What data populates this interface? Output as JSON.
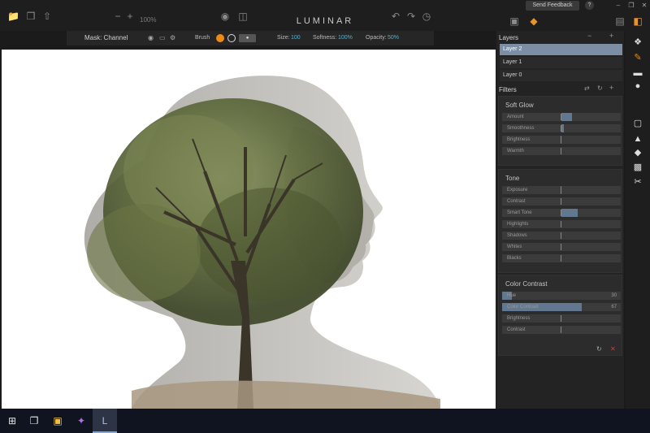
{
  "toolbar": {
    "zoom": "100%",
    "title": "LUMINAR",
    "feedback_label": "Send Feedback",
    "help_label": "?",
    "minimize": "–",
    "restore": "❐",
    "close": "✕"
  },
  "mask_bar": {
    "title": "Mask: Channel",
    "brush_label": "Brush",
    "size_label": "Size:",
    "size_value": "100",
    "softness_label": "Softness:",
    "softness_value": "100%",
    "opacity_label": "Opacity:",
    "opacity_value": "50%"
  },
  "layers": {
    "title": "Layers",
    "items": [
      {
        "label": "Layer 2",
        "active": true
      },
      {
        "label": "Layer 1",
        "active": false
      },
      {
        "label": "Layer 0",
        "active": false
      }
    ]
  },
  "filters": {
    "title": "Filters",
    "groups": [
      {
        "title": "Soft Glow",
        "sliders": [
          {
            "label": "Amount",
            "level": 0.59
          },
          {
            "label": "Smoothness",
            "level": 0.52
          },
          {
            "label": "Brightness",
            "level": 0.49
          },
          {
            "label": "Warmth",
            "level": 0.5
          }
        ]
      },
      {
        "title": "Tone",
        "sliders": [
          {
            "label": "Exposure",
            "level": 0.49
          },
          {
            "label": "Contrast",
            "level": 0.5
          },
          {
            "label": "Smart Tone",
            "level": 0.64
          },
          {
            "label": "Highlights",
            "level": 0.5
          },
          {
            "label": "Shadows",
            "level": 0.5
          },
          {
            "label": "Whites",
            "level": 0.5
          },
          {
            "label": "Blacks",
            "level": 0.5
          }
        ]
      },
      {
        "title": "Color Contrast",
        "sliders": [
          {
            "label": "Hue",
            "value": "30",
            "level": 0.08
          },
          {
            "label": "Color Contrast",
            "value": "67",
            "level": 0.67
          },
          {
            "label": "Brightness",
            "level": 0.5
          },
          {
            "label": "Contrast",
            "level": 0.5
          }
        ]
      }
    ]
  },
  "colors": {
    "accent_layer": "#7b8ea4",
    "slider_fill": "#627790",
    "value_text": "#4ab4d8",
    "brush_orange": "#f08a16",
    "delete_red": "#d93a2f"
  }
}
